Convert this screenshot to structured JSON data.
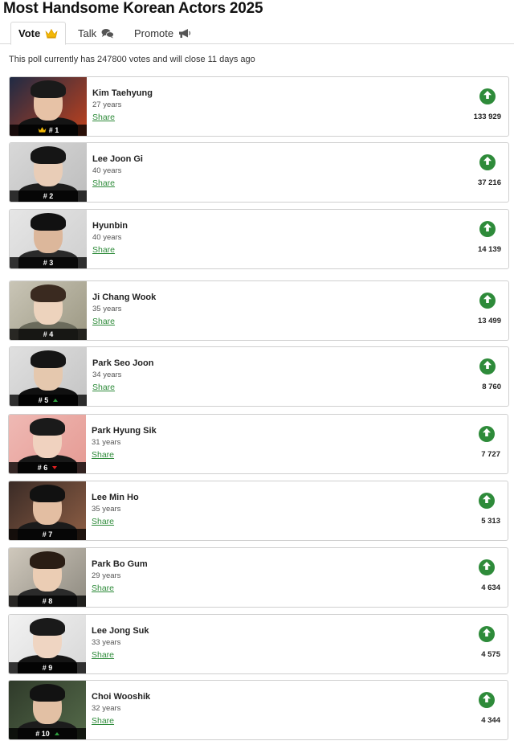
{
  "page": {
    "title": "Most Handsome Korean Actors 2025"
  },
  "tabs": [
    {
      "label": "Vote",
      "icon": "crown-icon"
    },
    {
      "label": "Talk",
      "icon": "chat-bubbles-icon"
    },
    {
      "label": "Promote",
      "icon": "megaphone-icon"
    }
  ],
  "poll": {
    "info": "This poll currently has 247800 votes and will close 11 days ago"
  },
  "share_label": "Share",
  "colors": {
    "accent_green": "#2e8b3a",
    "trend_up": "#2e9e3e",
    "trend_down": "#e02020",
    "crown_gold": "#f2b705"
  },
  "entries": [
    {
      "rank": "# 1",
      "name": "Kim Taehyung",
      "age": "27 years",
      "votes": "133 929",
      "trend": "crown"
    },
    {
      "rank": "# 2",
      "name": "Lee Joon Gi",
      "age": "40 years",
      "votes": "37 216",
      "trend": "none"
    },
    {
      "rank": "# 3",
      "name": "Hyunbin",
      "age": "40 years",
      "votes": "14 139",
      "trend": "none"
    },
    {
      "rank": "# 4",
      "name": "Ji Chang Wook",
      "age": "35 years",
      "votes": "13 499",
      "trend": "none"
    },
    {
      "rank": "# 5",
      "name": "Park Seo Joon",
      "age": "34 years",
      "votes": "8 760",
      "trend": "up"
    },
    {
      "rank": "# 6",
      "name": "Park Hyung Sik",
      "age": "31 years",
      "votes": "7 727",
      "trend": "down"
    },
    {
      "rank": "# 7",
      "name": "Lee Min Ho",
      "age": "35 years",
      "votes": "5 313",
      "trend": "none"
    },
    {
      "rank": "# 8",
      "name": "Park Bo Gum",
      "age": "29 years",
      "votes": "4 634",
      "trend": "none"
    },
    {
      "rank": "# 9",
      "name": "Lee Jong Suk",
      "age": "33 years",
      "votes": "4 575",
      "trend": "none"
    },
    {
      "rank": "# 10",
      "name": "Choi Wooshik",
      "age": "32 years",
      "votes": "4 344",
      "trend": "up"
    }
  ]
}
